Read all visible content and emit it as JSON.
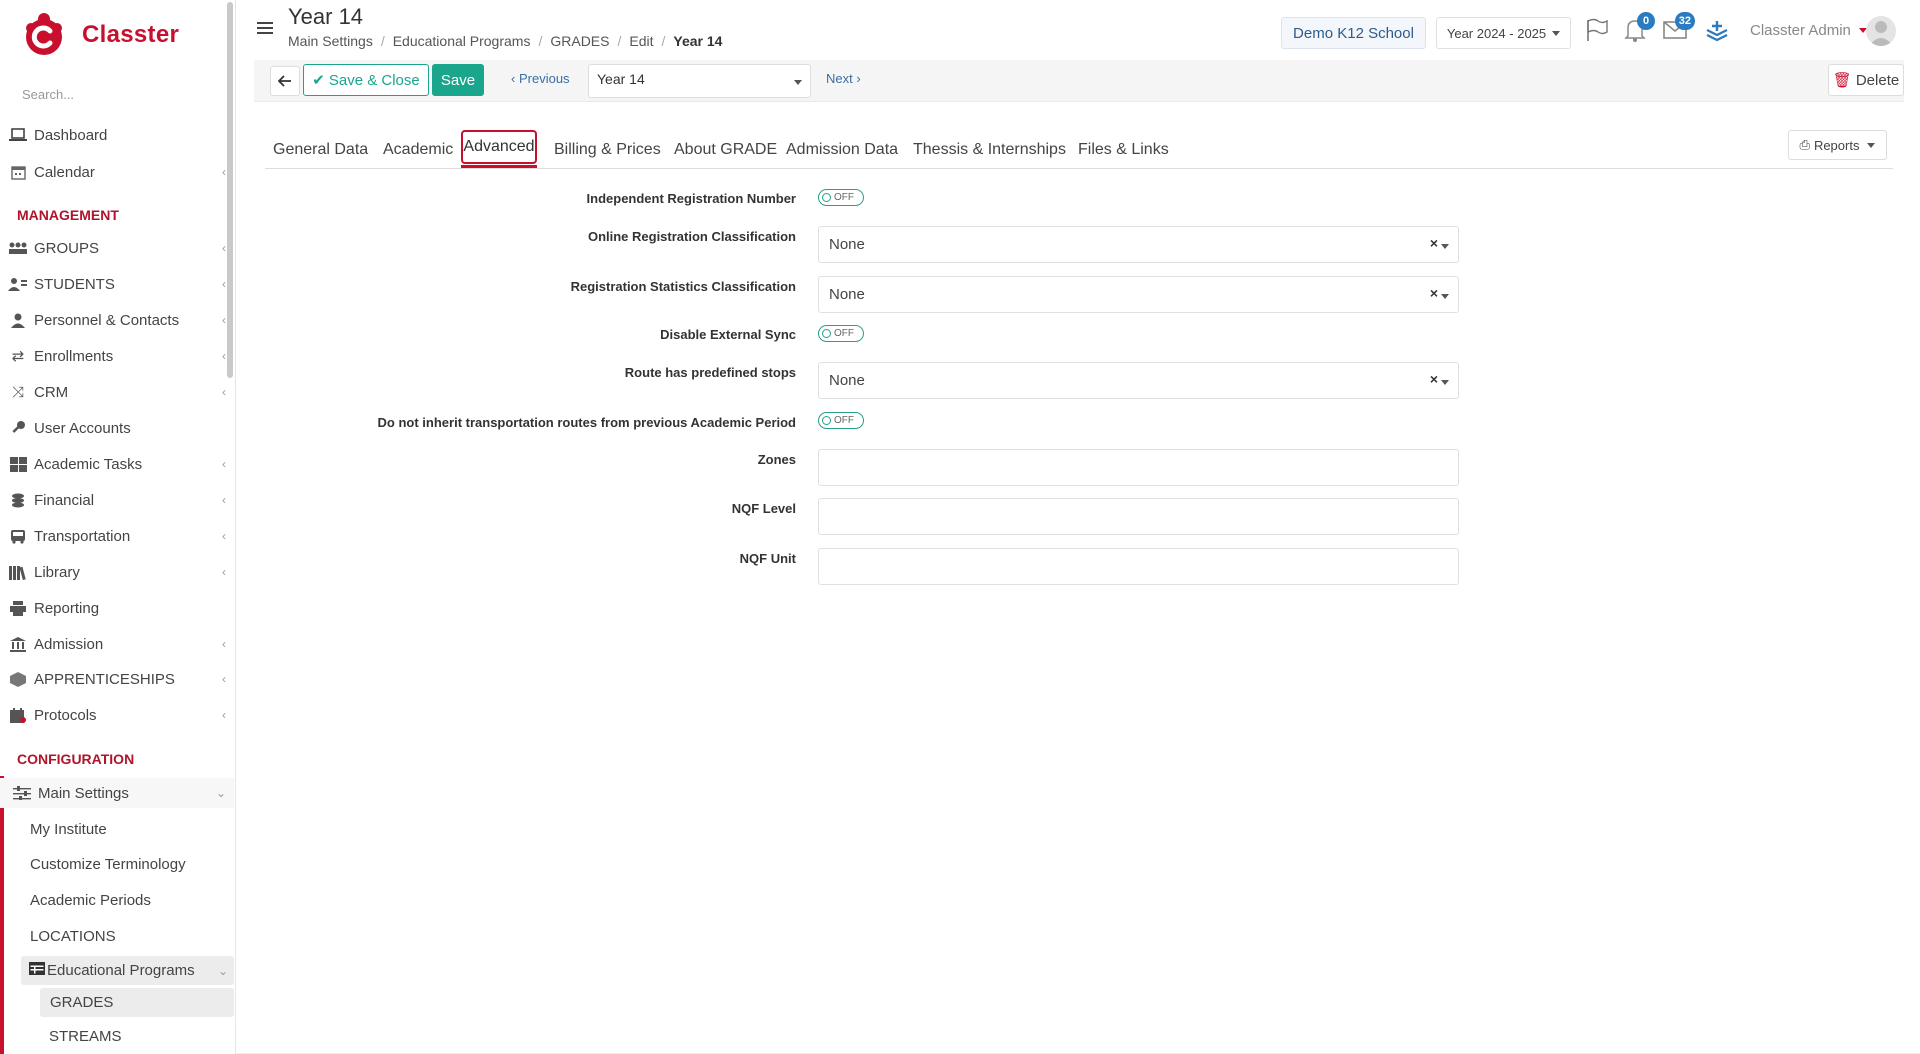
{
  "app": {
    "name": "Classter",
    "search_placeholder": "Search..."
  },
  "sidebar": {
    "top_items": [
      {
        "label": "Dashboard",
        "icon": "laptop-icon"
      },
      {
        "label": "Calendar",
        "icon": "calendar-icon"
      }
    ],
    "management_title": "MANAGEMENT",
    "management_items": [
      {
        "label": "GROUPS",
        "icon": "groups-icon"
      },
      {
        "label": "STUDENTS",
        "icon": "students-icon"
      },
      {
        "label": "Personnel & Contacts",
        "icon": "personnel-icon"
      },
      {
        "label": "Enrollments",
        "icon": "enrollments-icon"
      },
      {
        "label": "CRM",
        "icon": "crm-icon"
      },
      {
        "label": "User Accounts",
        "icon": "key-icon"
      },
      {
        "label": "Academic Tasks",
        "icon": "tasks-icon"
      },
      {
        "label": "Financial",
        "icon": "coins-icon"
      },
      {
        "label": "Transportation",
        "icon": "bus-icon"
      },
      {
        "label": "Library",
        "icon": "books-icon"
      },
      {
        "label": "Reporting",
        "icon": "printer-icon"
      },
      {
        "label": "Admission",
        "icon": "building-icon"
      },
      {
        "label": "APPRENTICESHIPS",
        "icon": "box-icon"
      },
      {
        "label": "Protocols",
        "icon": "protocols-icon"
      }
    ],
    "configuration_title": "CONFIGURATION",
    "main_settings": "Main Settings",
    "config_items": [
      {
        "label": "My Institute"
      },
      {
        "label": "Customize Terminology"
      },
      {
        "label": "Academic Periods"
      },
      {
        "label": "LOCATIONS"
      }
    ],
    "educational_programs": "Educational Programs",
    "ep_items": [
      {
        "label": "GRADES"
      },
      {
        "label": "STREAMS"
      }
    ]
  },
  "header": {
    "title": "Year 14",
    "breadcrumb": [
      "Main Settings",
      "Educational Programs",
      "GRADES",
      "Edit",
      "Year 14"
    ],
    "school": "Demo K12 School",
    "year": "Year 2024 - 2025",
    "notifications": "0",
    "messages": "32",
    "user": "Classter Admin"
  },
  "toolbar": {
    "save_close": "Save & Close",
    "save": "Save",
    "previous": "Previous",
    "record": "Year 14",
    "next": "Next",
    "delete": "Delete"
  },
  "tabs": [
    {
      "label": "General Data"
    },
    {
      "label": "Academic"
    },
    {
      "label": "Advanced",
      "active": true
    },
    {
      "label": "Billing & Prices"
    },
    {
      "label": "About GRADE"
    },
    {
      "label": "Admission Data"
    },
    {
      "label": "Thessis & Internships"
    },
    {
      "label": "Files & Links"
    }
  ],
  "reports": "Reports",
  "form": {
    "independent_reg": {
      "label": "Independent Registration Number",
      "value": "OFF"
    },
    "online_reg_class": {
      "label": "Online Registration Classification",
      "value": "None"
    },
    "reg_stats_class": {
      "label": "Registration Statistics Classification",
      "value": "None"
    },
    "disable_sync": {
      "label": "Disable External Sync",
      "value": "OFF"
    },
    "route_stops": {
      "label": "Route has predefined stops",
      "value": "None"
    },
    "no_inherit": {
      "label": "Do not inherit transportation routes from previous Academic Period",
      "value": "OFF"
    },
    "zones": {
      "label": "Zones",
      "value": ""
    },
    "nqf_level": {
      "label": "NQF Level",
      "value": ""
    },
    "nqf_unit": {
      "label": "NQF Unit",
      "value": ""
    }
  },
  "colors": {
    "brand": "#c8102e",
    "accent": "#1aa58d",
    "link": "#3a6ea5"
  }
}
